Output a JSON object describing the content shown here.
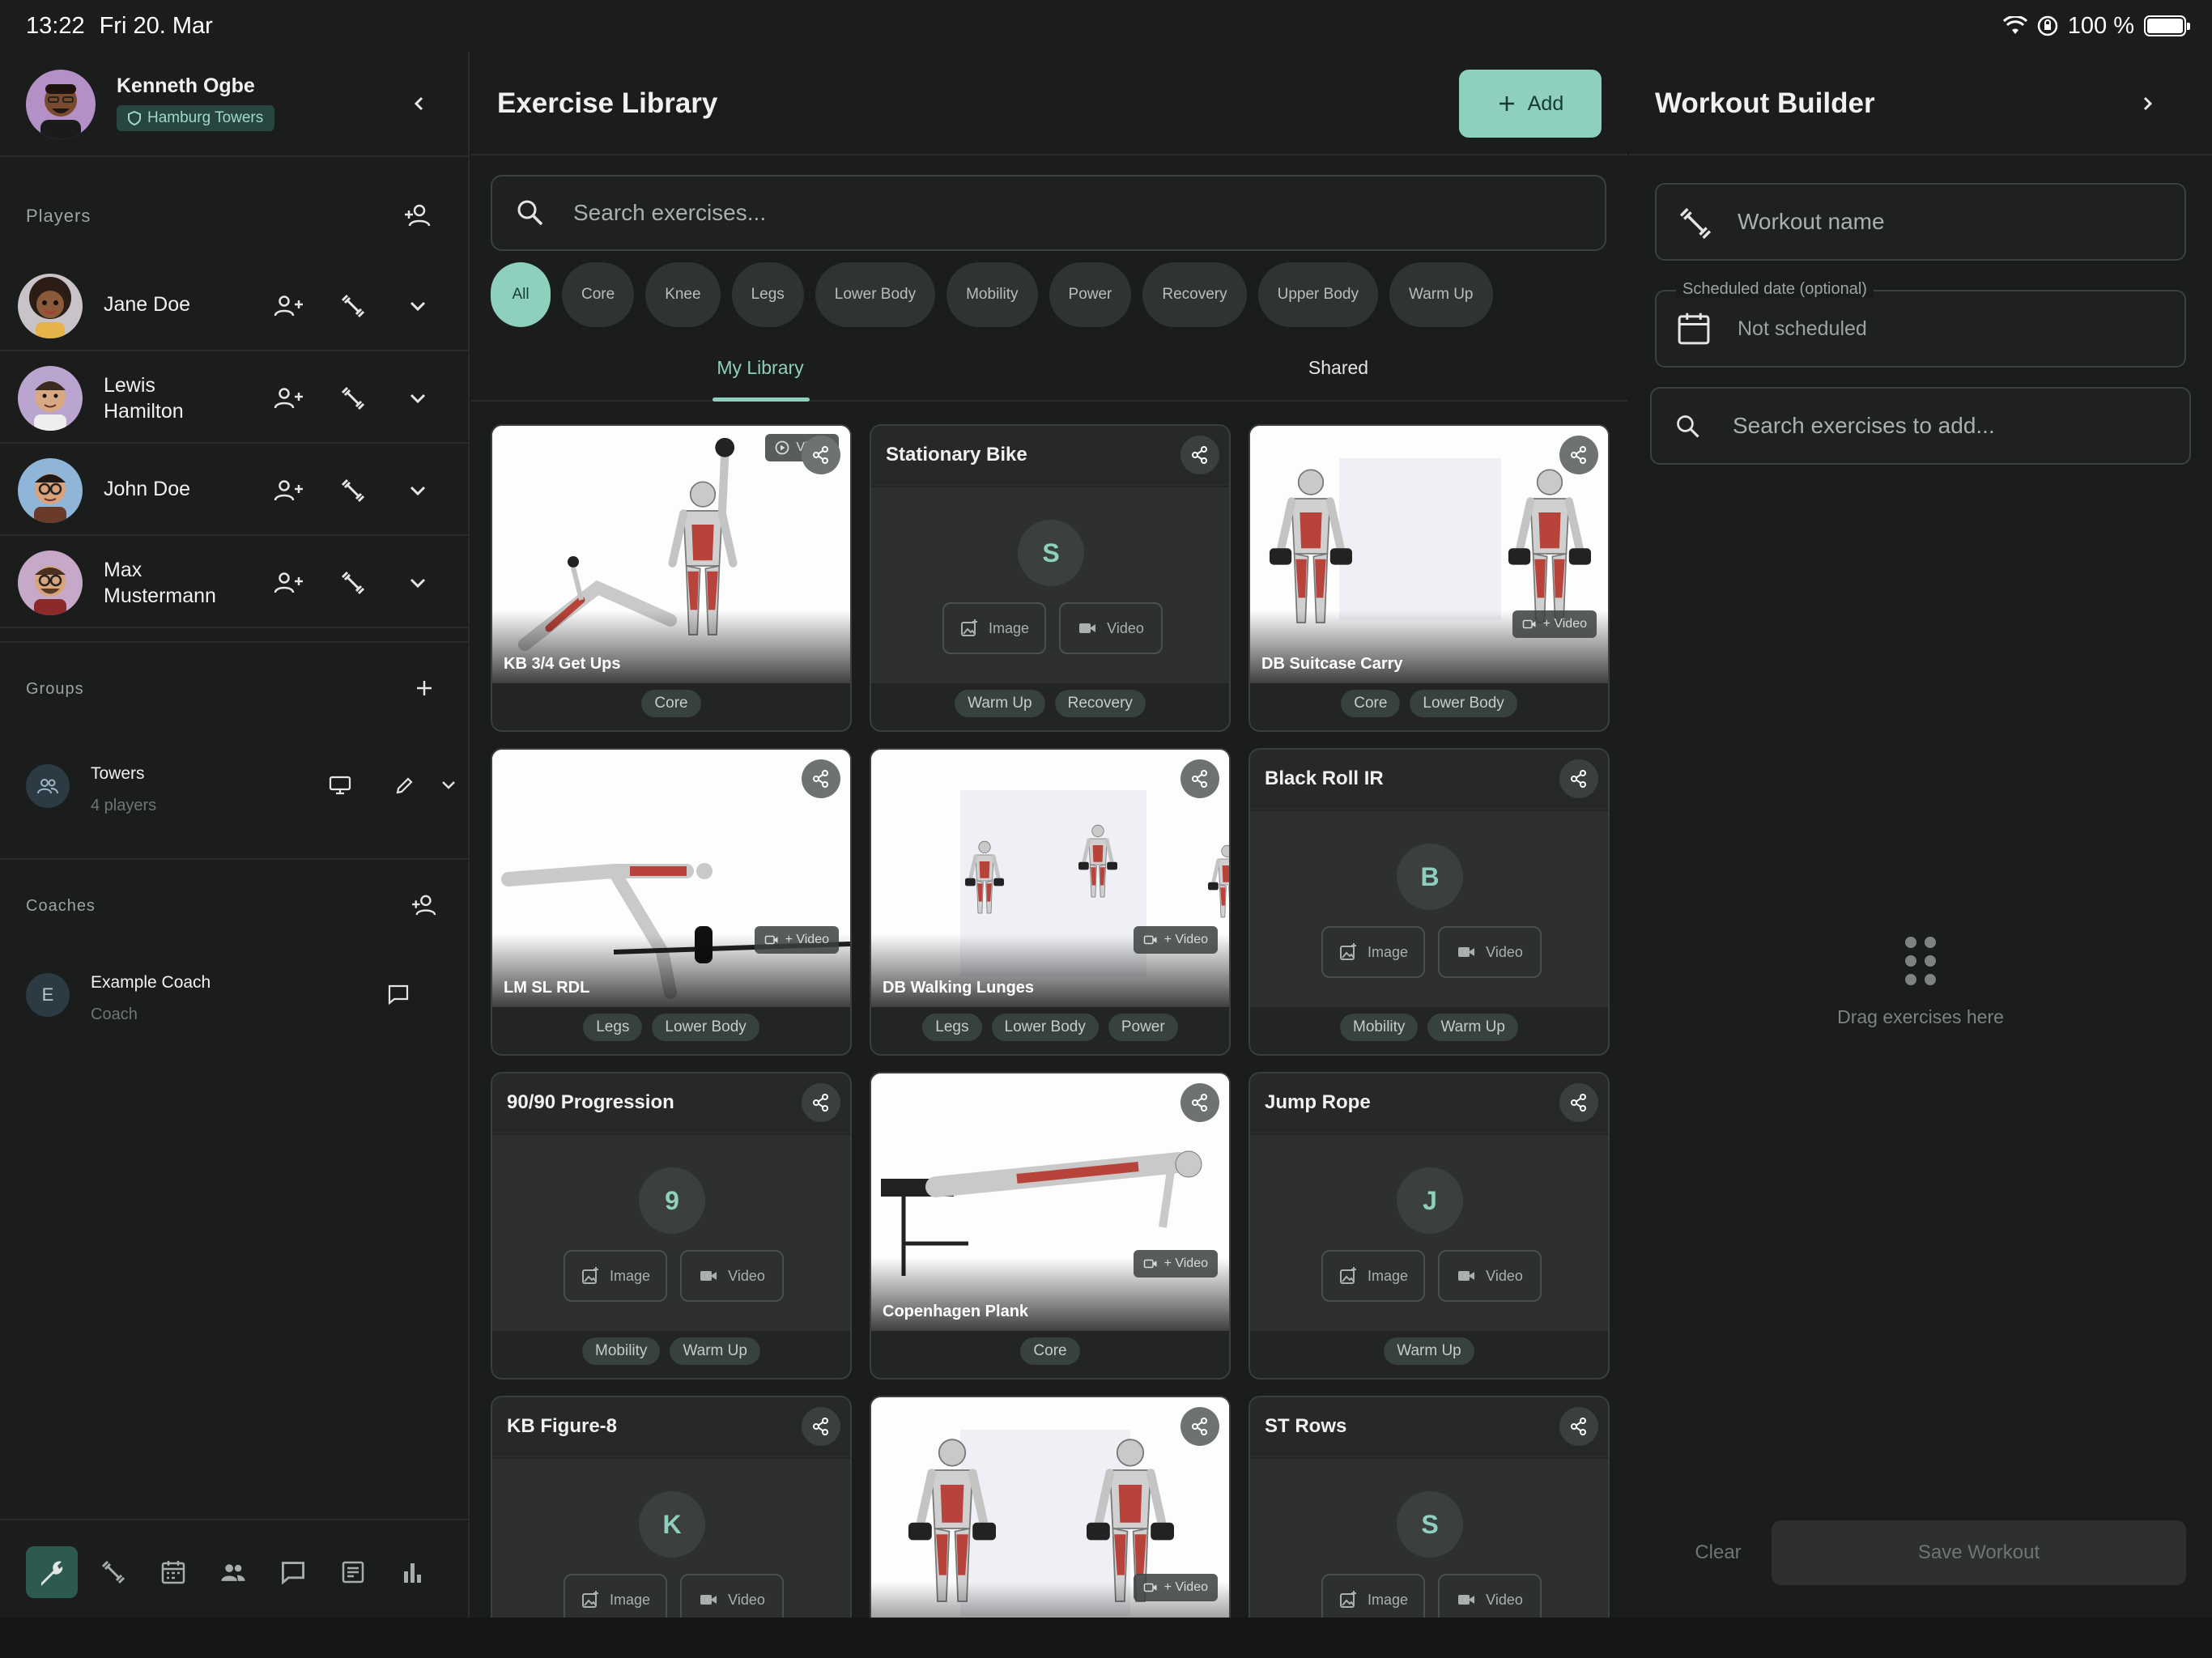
{
  "status_bar": {
    "time": "13:22",
    "date": "Fri 20. Mar",
    "battery": "100 %"
  },
  "user": {
    "name": "Kenneth Ogbe",
    "team": "Hamburg Towers"
  },
  "players": {
    "title": "Players",
    "items": [
      {
        "name": "Jane Doe"
      },
      {
        "name": "Lewis\nHamilton"
      },
      {
        "name": "John Doe"
      },
      {
        "name": "Max\nMustermann"
      }
    ]
  },
  "groups": {
    "title": "Groups",
    "items": [
      {
        "name": "Towers",
        "count": "4 players"
      }
    ]
  },
  "coaches": {
    "title": "Coaches",
    "items": [
      {
        "initial": "E",
        "name": "Example Coach",
        "role": "Coach"
      }
    ]
  },
  "library": {
    "title": "Exercise Library",
    "add_label": "Add",
    "search_placeholder": "Search exercises...",
    "filters": [
      "All",
      "Core",
      "Knee",
      "Legs",
      "Lower Body",
      "Mobility",
      "Power",
      "Recovery",
      "Upper Body",
      "Warm Up"
    ],
    "active_filter": "All",
    "tabs": [
      "My Library",
      "Shared"
    ],
    "active_tab": "My Library",
    "media_labels": {
      "image": "Image",
      "video": "Video",
      "add_video": "+ Video"
    },
    "cards": [
      {
        "title": "KB 3/4 Get Ups",
        "tags": [
          "Core"
        ],
        "has_image": true
      },
      {
        "title": "Stationary Bike",
        "initial": "S",
        "tags": [
          "Warm Up",
          "Recovery"
        ],
        "has_image": false
      },
      {
        "title": "DB Suitcase Carry",
        "tags": [
          "Core",
          "Lower Body"
        ],
        "has_image": true
      },
      {
        "title": "LM SL RDL",
        "tags": [
          "Legs",
          "Lower Body"
        ],
        "has_image": true
      },
      {
        "title": "DB Walking Lunges",
        "tags": [
          "Legs",
          "Lower Body",
          "Power"
        ],
        "has_image": true
      },
      {
        "title": "Black Roll IR",
        "initial": "B",
        "tags": [
          "Mobility",
          "Warm Up"
        ],
        "has_image": false
      },
      {
        "title": "90/90 Progression",
        "initial": "9",
        "tags": [
          "Mobility",
          "Warm Up"
        ],
        "has_image": false
      },
      {
        "title": "Copenhagen Plank",
        "tags": [
          "Core"
        ],
        "has_image": true
      },
      {
        "title": "Jump Rope",
        "initial": "J",
        "tags": [
          "Warm Up"
        ],
        "has_image": false
      },
      {
        "title": "KB Figure-8",
        "initial": "K",
        "tags": [],
        "has_image": false
      },
      {
        "title": "",
        "tags": [],
        "has_image": true
      },
      {
        "title": "ST Rows",
        "initial": "S",
        "tags": [],
        "has_image": false
      }
    ]
  },
  "builder": {
    "title": "Workout Builder",
    "workout_name_placeholder": "Workout name",
    "date_legend": "Scheduled date (optional)",
    "date_value": "Not scheduled",
    "search_placeholder": "Search exercises to add...",
    "drop_hint": "Drag exercises here",
    "clear_label": "Clear",
    "save_label": "Save Workout"
  },
  "colors": {
    "accent": "#8ecfbe",
    "background": "#1b1d1c",
    "card": "#222524"
  }
}
